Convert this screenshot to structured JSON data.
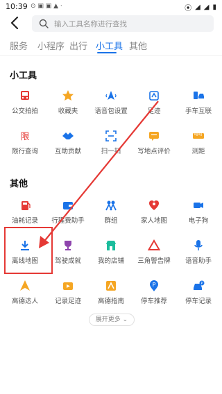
{
  "status_bar": {
    "time": "10:39",
    "left_icons": "⊙ ▣ ▣ ▲ ·",
    "battery": "▮"
  },
  "search": {
    "placeholder": "输入工具名称进行查找"
  },
  "tabs": [
    "服务",
    "小程序",
    "出行",
    "小工具",
    "其他"
  ],
  "active_tab_index": 3,
  "sections": [
    {
      "title": "小工具",
      "items": [
        {
          "label": "公交拍拍",
          "icon": "bus-icon",
          "color": "#e53935"
        },
        {
          "label": "收藏夹",
          "icon": "star-icon",
          "color": "#f5a623"
        },
        {
          "label": "语音包设置",
          "icon": "voice-pack-icon",
          "color": "#1a73e8"
        },
        {
          "label": "足迹",
          "icon": "footprint-icon",
          "color": "#1a73e8"
        },
        {
          "label": "手车互联",
          "icon": "phone-car-icon",
          "color": "#1a73e8"
        },
        {
          "label": "限行查询",
          "icon": "restriction-icon",
          "color": "#e53935"
        },
        {
          "label": "互助贡献",
          "icon": "handshake-icon",
          "color": "#1a73e8"
        },
        {
          "label": "扫一扫",
          "icon": "scan-icon",
          "color": "#1a73e8"
        },
        {
          "label": "写地点评价",
          "icon": "comment-icon",
          "color": "#f5a623"
        },
        {
          "label": "测距",
          "icon": "ruler-icon",
          "color": "#f5a623"
        }
      ]
    },
    {
      "title": "其他",
      "items": [
        {
          "label": "油耗记录",
          "icon": "fuel-icon",
          "color": "#e53935"
        },
        {
          "label": "行程费助手",
          "icon": "wallet-icon",
          "color": "#1a73e8"
        },
        {
          "label": "群组",
          "icon": "group-icon",
          "color": "#1a73e8"
        },
        {
          "label": "家人地图",
          "icon": "family-map-icon",
          "color": "#e53935"
        },
        {
          "label": "电子狗",
          "icon": "camera-icon",
          "color": "#1a73e8"
        },
        {
          "label": "离线地图",
          "icon": "download-icon",
          "color": "#1a73e8"
        },
        {
          "label": "驾驶成就",
          "icon": "trophy-icon",
          "color": "#8e44ad"
        },
        {
          "label": "我的店铺",
          "icon": "store-icon",
          "color": "#1abc9c"
        },
        {
          "label": "三角警告牌",
          "icon": "warning-triangle-icon",
          "color": "#e53935"
        },
        {
          "label": "语音助手",
          "icon": "microphone-icon",
          "color": "#1a73e8"
        },
        {
          "label": "高德达人",
          "icon": "expert-icon",
          "color": "#f5a623"
        },
        {
          "label": "记录足迹",
          "icon": "video-record-icon",
          "color": "#f5a623"
        },
        {
          "label": "高德指南",
          "icon": "guide-icon",
          "color": "#f5a623"
        },
        {
          "label": "停车推荐",
          "icon": "parking-pin-icon",
          "color": "#1a73e8"
        },
        {
          "label": "停车记录",
          "icon": "parking-car-icon",
          "color": "#1a73e8"
        }
      ]
    }
  ],
  "more_button": "展开更多"
}
